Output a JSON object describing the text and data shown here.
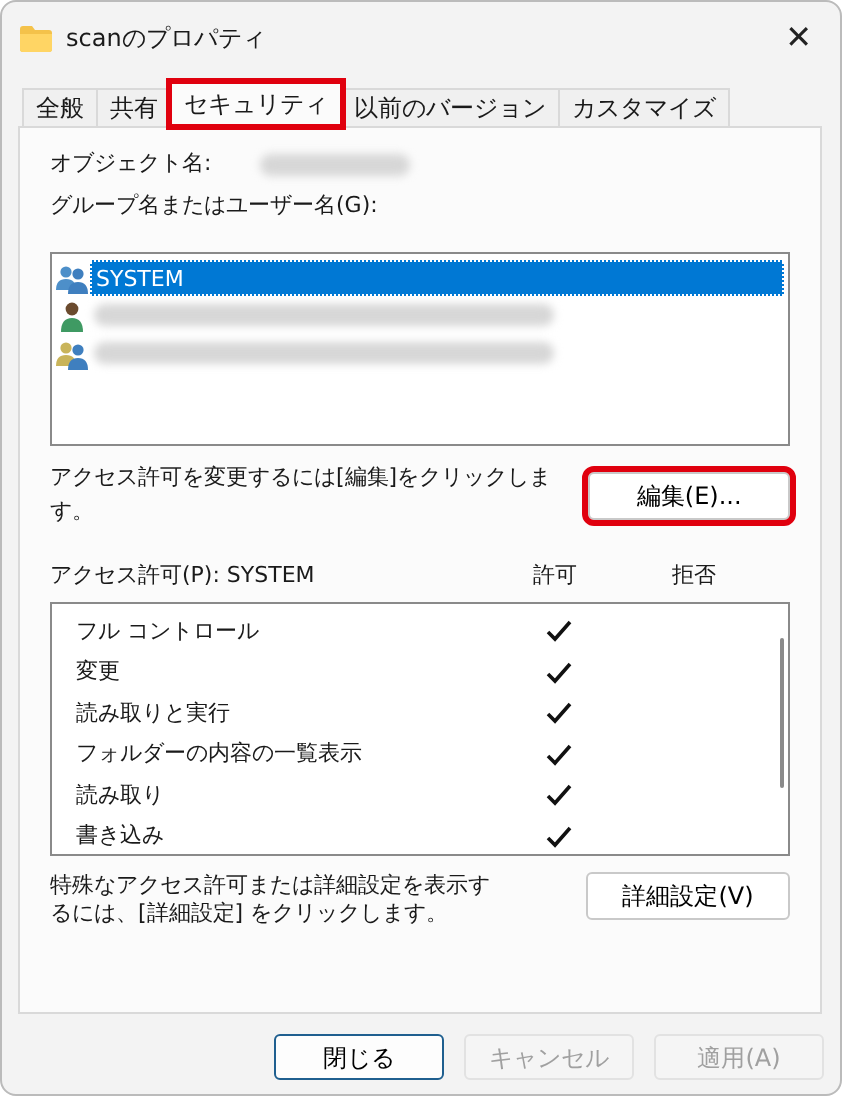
{
  "window": {
    "title": "scanのプロパティ",
    "close": "✕"
  },
  "tabs": [
    {
      "label": "全般",
      "selected": false,
      "highlighted": false
    },
    {
      "label": "共有",
      "selected": false,
      "highlighted": false
    },
    {
      "label": "セキュリティ",
      "selected": true,
      "highlighted": true
    },
    {
      "label": "以前のバージョン",
      "selected": false,
      "highlighted": false
    },
    {
      "label": "カスタマイズ",
      "selected": false,
      "highlighted": false
    }
  ],
  "object_name": {
    "label": "オブジェクト名:",
    "redacted": true
  },
  "users_label": "グループ名またはユーザー名(G):",
  "users": [
    {
      "kind": "group",
      "label": "SYSTEM",
      "selected": true,
      "redacted": false
    },
    {
      "kind": "user",
      "selected": false,
      "redacted": true
    },
    {
      "kind": "group-mixed",
      "selected": false,
      "redacted": true
    }
  ],
  "edit_hint": "アクセス許可を変更するには[編集]をクリックします。",
  "edit_button": {
    "label": "編集(E)...",
    "highlighted": true
  },
  "permissions": {
    "title": "アクセス許可(P): SYSTEM",
    "allow_column": "許可",
    "deny_column": "拒否",
    "rows": [
      {
        "name": "フル コントロール",
        "allow": true,
        "deny": false
      },
      {
        "name": "変更",
        "allow": true,
        "deny": false
      },
      {
        "name": "読み取りと実行",
        "allow": true,
        "deny": false
      },
      {
        "name": "フォルダーの内容の一覧表示",
        "allow": true,
        "deny": false
      },
      {
        "name": "読み取り",
        "allow": true,
        "deny": false
      },
      {
        "name": "書き込み",
        "allow": true,
        "deny": false
      }
    ]
  },
  "advanced_hint": "特殊なアクセス許可または詳細設定を表示するには、[詳細設定] をクリックします。",
  "advanced_button": "詳細設定(V)",
  "buttons": [
    {
      "label": "閉じる",
      "disabled": false,
      "default": true
    },
    {
      "label": "キャンセル",
      "disabled": true,
      "default": false
    },
    {
      "label": "適用(A)",
      "disabled": true,
      "default": false
    }
  ]
}
